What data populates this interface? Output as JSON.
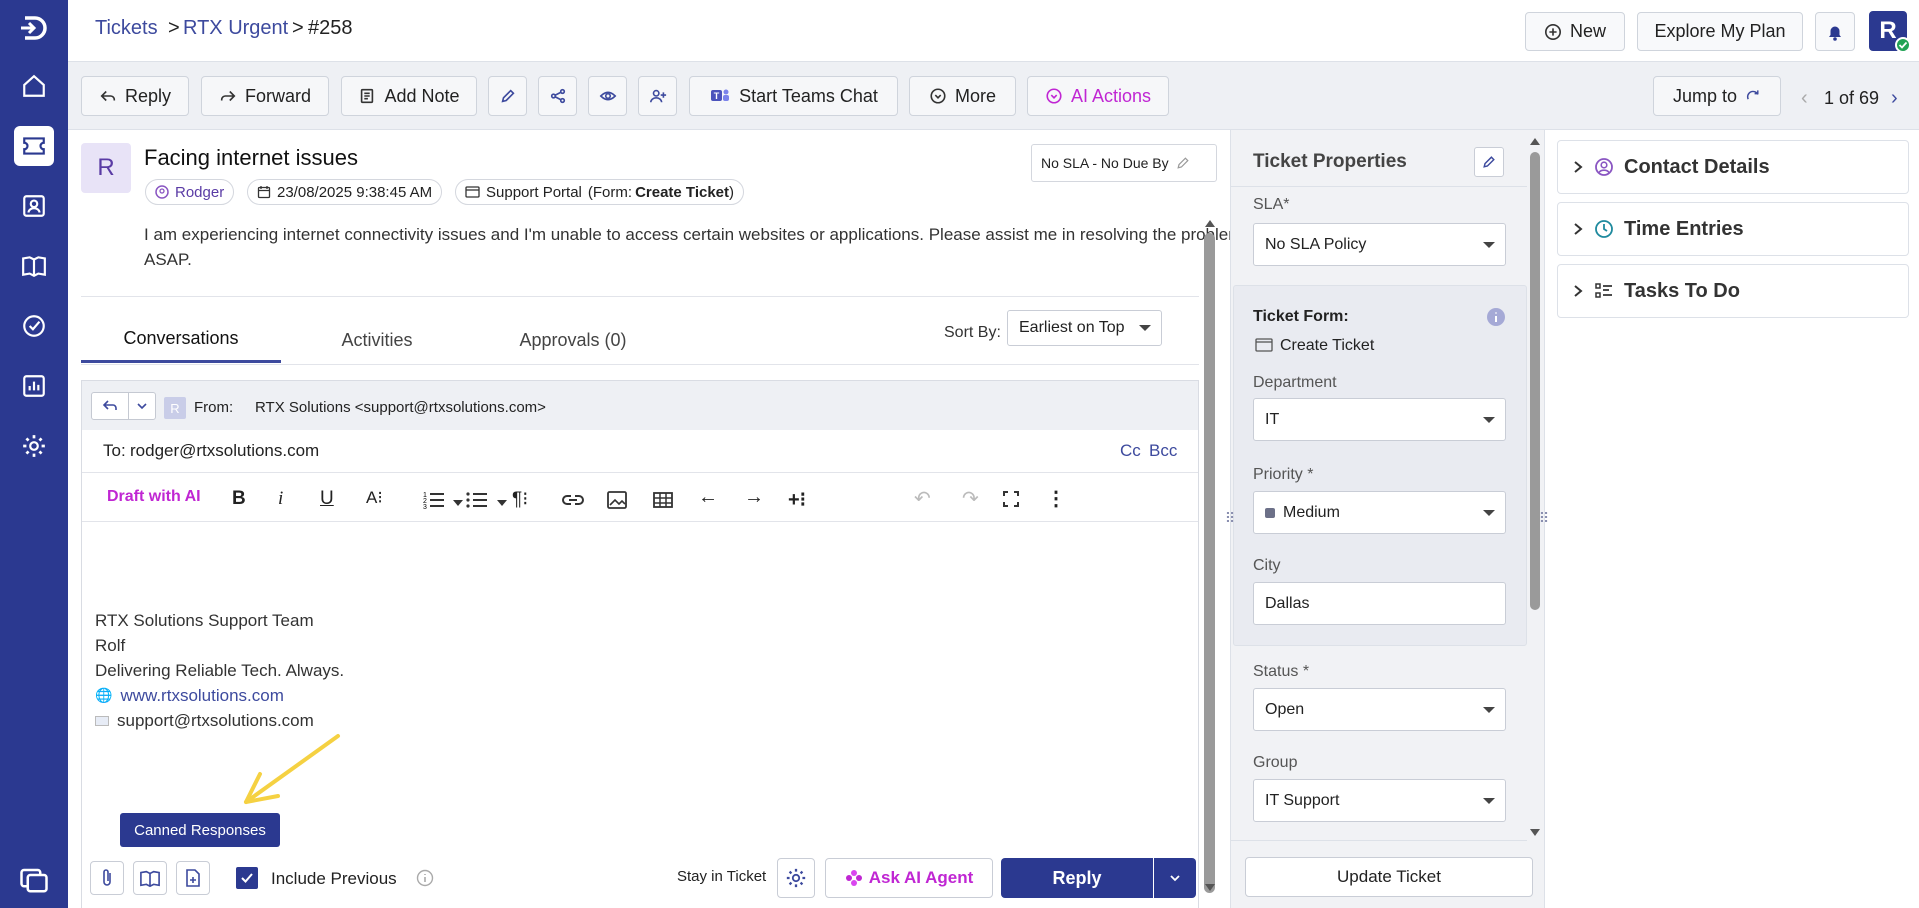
{
  "sidebar": {
    "items": [
      "logo-icon",
      "home-icon",
      "tickets-icon",
      "contacts-icon",
      "knowledge-base-icon",
      "tasks-icon",
      "reports-icon",
      "settings-icon",
      "chat-icon"
    ]
  },
  "breadcrumb": {
    "root": "Tickets",
    "sep1": ">",
    "queue": "RTX Urgent",
    "sep2": ">",
    "ticket": "#258"
  },
  "header": {
    "new_label": "New",
    "plan_label": "Explore My Plan",
    "avatar_letter": "R"
  },
  "toolbar": {
    "reply": "Reply",
    "forward": "Forward",
    "add_note": "Add Note",
    "teams": "Start Teams Chat",
    "more": "More",
    "ai_actions": "AI Actions",
    "jump_to": "Jump to",
    "pager": "1 of 69"
  },
  "ticket": {
    "avatar_letter": "R",
    "title": "Facing internet issues",
    "requester": "Rodger",
    "created": "23/08/2025 9:38:45 AM",
    "source": "Support Portal",
    "form_prefix": "(Form:",
    "form_name": "Create Ticket",
    "form_suffix": ")",
    "sla_badge": "No SLA - No Due By",
    "description": "I am experiencing internet connectivity issues and I'm unable to access certain websites or applications. Please assist me in resolving the problem ASAP."
  },
  "tabs": [
    {
      "label": "Conversations"
    },
    {
      "label": "Activities"
    },
    {
      "label": "Approvals (0)"
    }
  ],
  "sort": {
    "label": "Sort By:",
    "value": "Earliest on Top"
  },
  "composer": {
    "from_label": "From:",
    "from_value": "RTX Solutions <support@rtxsolutions.com>",
    "from_avatar": "R",
    "to_label": "To:",
    "to_value": "rodger@rtxsolutions.com",
    "cc": "Cc",
    "bcc": "Bcc",
    "draft_ai": "Draft with AI",
    "sig_team": "RTX Solutions Support Team",
    "sig_name": "Rolf",
    "sig_tagline": "Delivering Reliable Tech. Always.",
    "sig_web": "www.rtxsolutions.com",
    "sig_email": "support@rtxsolutions.com",
    "canned_tooltip": "Canned Responses",
    "include_previous": "Include Previous",
    "include_previous_checked": true,
    "stay_in_ticket": "Stay in Ticket",
    "ask_ai": "Ask AI Agent",
    "reply_btn": "Reply"
  },
  "properties": {
    "title": "Ticket Properties",
    "sla_label": "SLA*",
    "sla_value": "No SLA Policy",
    "form_label": "Ticket Form:",
    "form_value": "Create Ticket",
    "dept_label": "Department",
    "dept_value": "IT",
    "priority_label": "Priority",
    "priority_value": "Medium",
    "city_label": "City",
    "city_value": "Dallas",
    "status_label": "Status",
    "status_value": "Open",
    "group_label": "Group",
    "group_value": "IT Support",
    "required_mark": "*",
    "update_btn": "Update Ticket"
  },
  "right_panel": {
    "contact": "Contact Details",
    "time": "Time Entries",
    "tasks": "Tasks To Do"
  },
  "colors": {
    "brand": "#2b3990",
    "ai_magenta": "#c026d3",
    "link": "#3d4a9e",
    "annotation_arrow": "#f5d142"
  }
}
